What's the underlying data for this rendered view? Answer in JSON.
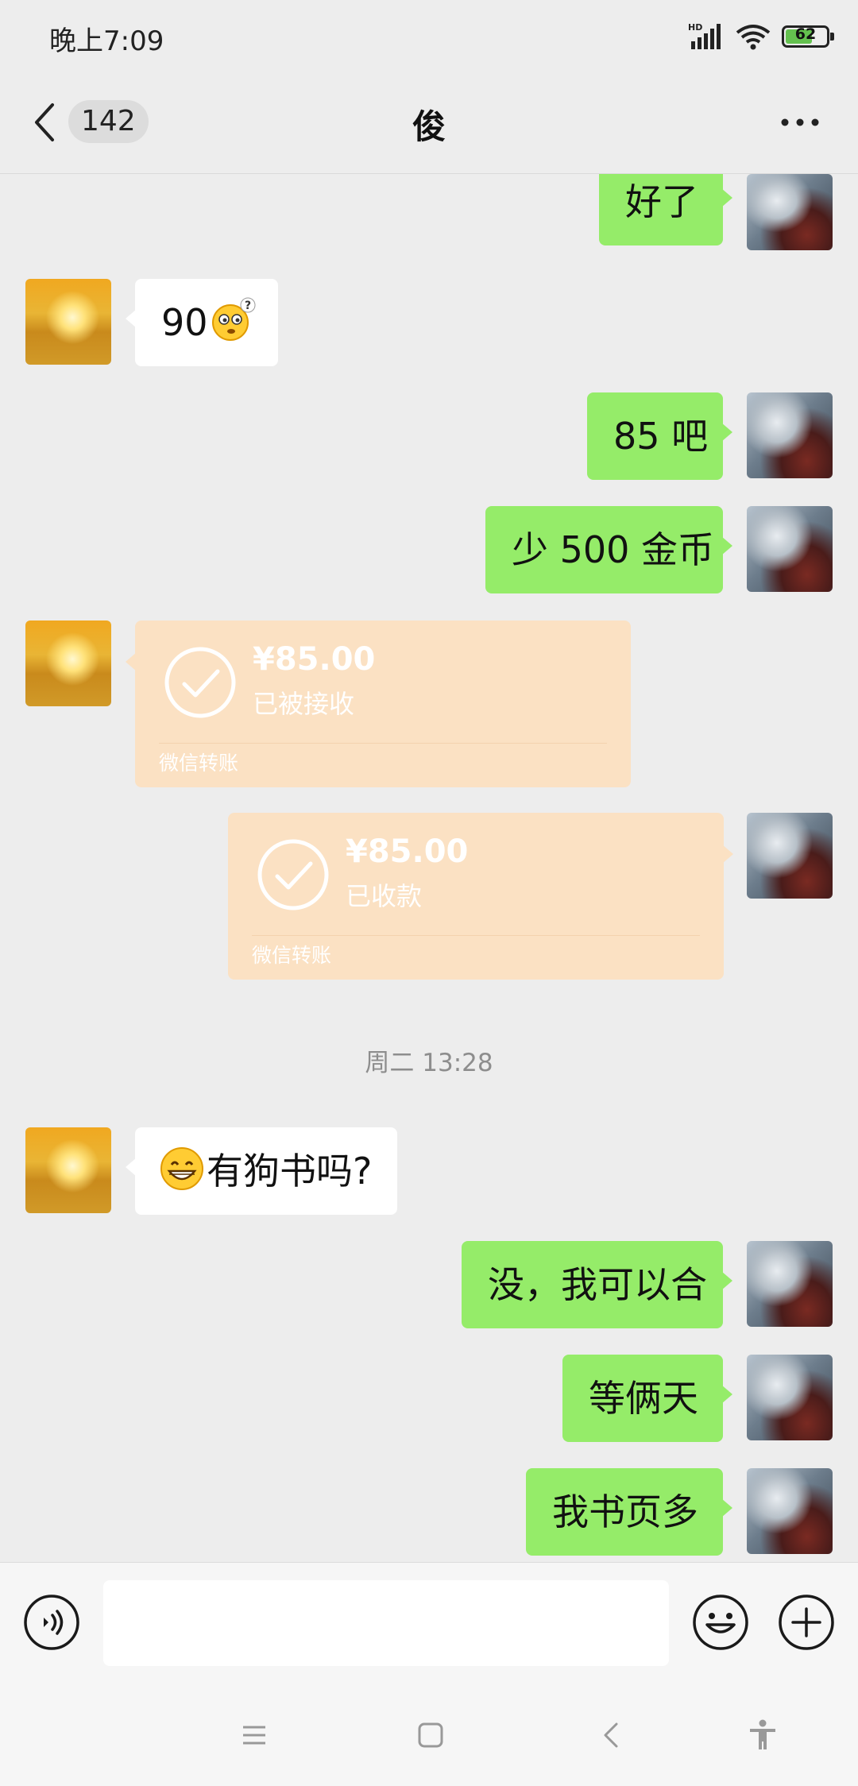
{
  "status_bar": {
    "time": "晚上7:09",
    "network_label": "HD",
    "battery_percent": "62"
  },
  "header": {
    "unread_count": "142",
    "title": "俊"
  },
  "messages": [
    {
      "side": "out",
      "text": "好了"
    },
    {
      "side": "in",
      "text": "90",
      "emoji": "thinking-face-emoji"
    },
    {
      "side": "out",
      "text": "85 吧"
    },
    {
      "side": "out",
      "text": "少 500 金币"
    },
    {
      "side": "in",
      "type": "transfer",
      "amount": "¥85.00",
      "status": "已被接收",
      "brand": "微信转账"
    },
    {
      "side": "out",
      "type": "transfer",
      "amount": "¥85.00",
      "status": "已收款",
      "brand": "微信转账"
    },
    {
      "side": "in",
      "emoji": "grinning-face-emoji",
      "text": "有狗书吗?"
    },
    {
      "side": "out",
      "text": "没，我可以合"
    },
    {
      "side": "out",
      "text": "等俩天"
    },
    {
      "side": "out",
      "text": "我书页多"
    }
  ],
  "timestamp": "周二 13:28",
  "input_bar": {
    "placeholder": "",
    "value": ""
  },
  "colors": {
    "outgoing_bubble": "#95ec69",
    "incoming_bubble": "#ffffff",
    "transfer_card": "#fbe1c3",
    "background": "#ededed"
  }
}
